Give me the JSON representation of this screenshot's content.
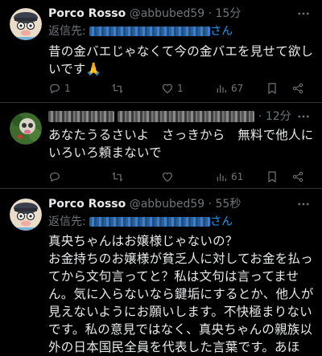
{
  "tweets": [
    {
      "author": "Porco Rosso",
      "handle": "@abbubed59",
      "time": "15分",
      "reply_prefix": "返信先:",
      "reply_suffix": "さん",
      "text": "昔の金バエじゃなくて今の金バエを見せて欲しいです🙏",
      "stats": {
        "replies": "1",
        "retweets": "",
        "likes": "1",
        "views": "67"
      }
    },
    {
      "time": "12分",
      "text": "あなたうるさいよ　さっきから　無料で他人にいろいろ頼まないで",
      "stats": {
        "replies": "",
        "retweets": "",
        "likes": "",
        "views": "61"
      }
    },
    {
      "author": "Porco Rosso",
      "handle": "@abbubed59",
      "time": "55秒",
      "reply_prefix": "返信先:",
      "reply_suffix": "さん",
      "text": "真央ちゃんはお嬢様じゃないの？\nお金持ちのお嬢様が貧乏人に対してお金を払ってから文句言ってと？私は文句は言ってません。気に入らないなら鍵垢にするとか、他人が見えないようにお願いします。不快極まりないです。私の意見ではなく、真央ちゃんの親族以外の日本国民全員を代表した言葉です。あほ"
    }
  ],
  "colors": {
    "background": "#000000",
    "text": "#e7e9ea",
    "muted": "#71767b",
    "link": "#1d9bf0",
    "divider": "#2f3336"
  }
}
